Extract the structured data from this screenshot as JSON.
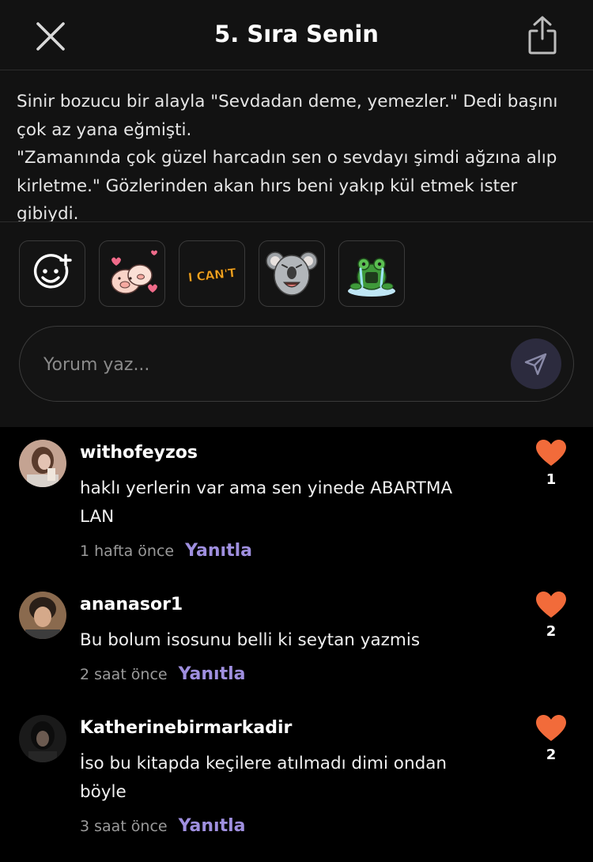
{
  "header": {
    "title": "5. Sıra Senin"
  },
  "quote": {
    "text": "Sinir bozucu bir alayla \"Sevdadan deme, yemezler.\" Dedi başını çok az yana eğmişti.\n\"Zamanında çok güzel harcadın sen o sevdayı şimdi ağzına alıp kirletme.\" Gözlerinden akan hırs beni yakıp kül etmek ister gibiydi."
  },
  "stickers": [
    {
      "name": "add-sticker-icon"
    },
    {
      "name": "pig-sticker"
    },
    {
      "name": "i-cant-sticker",
      "text": "I CAN'T"
    },
    {
      "name": "koala-sticker"
    },
    {
      "name": "frog-sticker"
    }
  ],
  "comment_box": {
    "placeholder": "Yorum yaz..."
  },
  "comments": [
    {
      "username": "withofeyzos",
      "text": "haklı yerlerin var ama sen yinede ABARTMA LAN",
      "time": "1 hafta önce",
      "reply_label": "Yanıtla",
      "likes": "1"
    },
    {
      "username": "ananasor1",
      "text": "Bu bolum isosunu belli ki seytan yazmis",
      "time": "2 saat önce",
      "reply_label": "Yanıtla",
      "likes": "2"
    },
    {
      "username": "Katherinebirmarkadir",
      "text": "İso bu kitapda keçilere atılmadı dimi ondan böyle",
      "time": "3 saat önce",
      "reply_label": "Yanıtla",
      "likes": "2"
    }
  ],
  "colors": {
    "accent": "#9f8fdf",
    "heart": "#f26b3a",
    "background": "#000000",
    "panel": "#121212"
  }
}
